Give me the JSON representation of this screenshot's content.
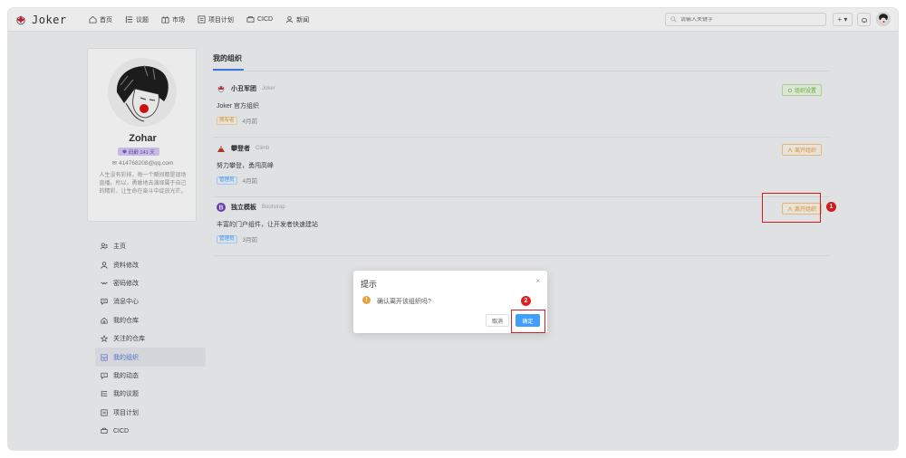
{
  "app": {
    "brand": "Joker"
  },
  "nav": [
    {
      "label": "首页",
      "icon": "home-icon"
    },
    {
      "label": "议题",
      "icon": "issues-icon"
    },
    {
      "label": "市场",
      "icon": "market-icon"
    },
    {
      "label": "项目计划",
      "icon": "plan-icon"
    },
    {
      "label": "CICD",
      "icon": "cicd-icon"
    },
    {
      "label": "新闻",
      "icon": "news-icon"
    }
  ],
  "search": {
    "placeholder": "请输入关键字"
  },
  "header": {
    "add_label": "+ ▾"
  },
  "profile": {
    "name": "Zohar",
    "badge": "码龄 141 天",
    "email": "414768208@qq.com",
    "bio": "人生没有彩排，每一个瞬间都是现场直播。所以，勇敢地去演绎属于自己的精彩，让生命在奋斗中绽放光芒。"
  },
  "menu": [
    {
      "label": "主页",
      "icon": "profile-home-icon",
      "active": false
    },
    {
      "label": "资料修改",
      "icon": "user-icon",
      "active": false
    },
    {
      "label": "密码修改",
      "icon": "key-icon",
      "active": false
    },
    {
      "label": "消息中心",
      "icon": "message-icon",
      "active": false
    },
    {
      "label": "我的仓库",
      "icon": "repo-icon",
      "active": false
    },
    {
      "label": "关注的仓库",
      "icon": "star-icon",
      "active": false
    },
    {
      "label": "我的组织",
      "icon": "org-icon",
      "active": true
    },
    {
      "label": "我的动态",
      "icon": "activity-icon",
      "active": false
    },
    {
      "label": "我的议题",
      "icon": "issue-list-icon",
      "active": false
    },
    {
      "label": "项目计划",
      "icon": "project-icon",
      "active": false
    },
    {
      "label": "CICD",
      "icon": "pipeline-icon",
      "active": false
    }
  ],
  "main": {
    "section_title": "我的组织",
    "orgs": [
      {
        "name": "小丑军团",
        "sub": "Joker",
        "desc": "Joker 官方组织",
        "role": "拥有者",
        "time": "4月前",
        "action": "组织设置",
        "icon": "joker-icon"
      },
      {
        "name": "攀登者",
        "sub": "Climb",
        "desc": "努力攀登，勇闯高峰",
        "role": "管理员",
        "time": "4月前",
        "action": "离开组织",
        "icon": "climb-icon"
      },
      {
        "name": "独立模板",
        "sub": "Bootstrap",
        "desc": "丰富的门户组件，让开发者快速建站",
        "role": "管理员",
        "time": "3月前",
        "action": "离开组织",
        "icon": "bootstrap-icon"
      }
    ]
  },
  "dialog": {
    "title": "提示",
    "message": "确认离开该组织吗?",
    "cancel": "取消",
    "confirm": "确定",
    "close": "×"
  },
  "annotations": {
    "step1": "1",
    "step2": "2"
  },
  "colors": {
    "primary": "#409eff",
    "warning": "#e6a23c",
    "success": "#67c23a",
    "annotation": "#e02020"
  }
}
